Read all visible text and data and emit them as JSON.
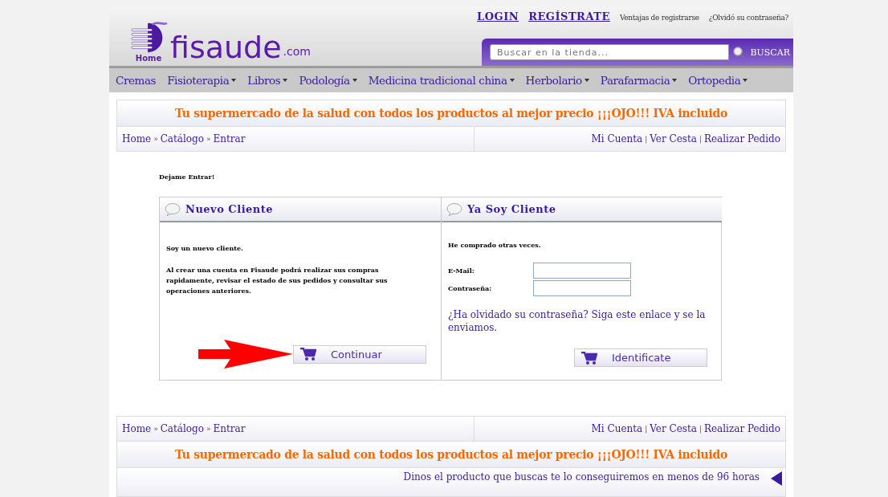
{
  "logo": {
    "home": "Home",
    "name": "fisaude",
    "suffix": ".com"
  },
  "top_links": [
    {
      "label": "LOGIN",
      "kind": "major"
    },
    {
      "label": "REGÍSTRATE",
      "kind": "major"
    },
    {
      "label": "Ventajas de registrarse",
      "kind": "minor"
    },
    {
      "label": "¿Olvidó su contraseña?",
      "kind": "minor"
    }
  ],
  "search": {
    "placeholder": "Buscar en la tienda...",
    "button": "BUSCAR"
  },
  "nav": [
    {
      "label": "Cremas",
      "dropdown": false
    },
    {
      "label": "Fisioterapia",
      "dropdown": true
    },
    {
      "label": "Libros",
      "dropdown": true
    },
    {
      "label": "Podología",
      "dropdown": true
    },
    {
      "label": "Medicina tradicional china",
      "dropdown": true
    },
    {
      "label": "Herbolario",
      "dropdown": true
    },
    {
      "label": "Parafarmacia",
      "dropdown": true
    },
    {
      "label": "Ortopedia",
      "dropdown": true
    }
  ],
  "promo": "Tu supermercado de la salud con todos los productos al mejor precio ¡¡¡OJO!!! IVA incluido",
  "crumb_separator": "»",
  "link_separator": "|",
  "breadcrumb": [
    "Home",
    "Catálogo",
    "Entrar"
  ],
  "account_links": [
    "Mi Cuenta",
    "Ver Cesta",
    "Realizar Pedido"
  ],
  "page_title": "Dejame Entrar!",
  "new_customer": {
    "title": "Nuevo Cliente",
    "intro": "Soy un nuevo cliente.",
    "text": "Al crear una cuenta en Fisaude podrá realizar sus compras rapidamente, revisar el estado de sus pedidos y consultar sus operaciones anteriores.",
    "button": "Continuar"
  },
  "existing_customer": {
    "title": "Ya Soy Cliente",
    "intro": "He comprado otras veces.",
    "fields": [
      {
        "label": "E-Mail:"
      },
      {
        "label": "Contraseña:"
      }
    ],
    "forgot_link": "¿Ha olvidado su contraseña? Siga este enlace y se la enviamos.",
    "button": "Identificate"
  },
  "bottom_breadcrumb": [
    "Home",
    "Catálogo",
    "Entrar"
  ],
  "bottom_account_links": [
    "Mi Cuenta",
    "Ver Cesta",
    "Realizar Pedido"
  ],
  "bottom_promo": "Tu supermercado de la salud con todos los productos al mejor precio ¡¡¡OJO!!! IVA incluido",
  "footer_note": "Dinos el producto que buscas te lo conseguiremos en menos de 96 horas"
}
